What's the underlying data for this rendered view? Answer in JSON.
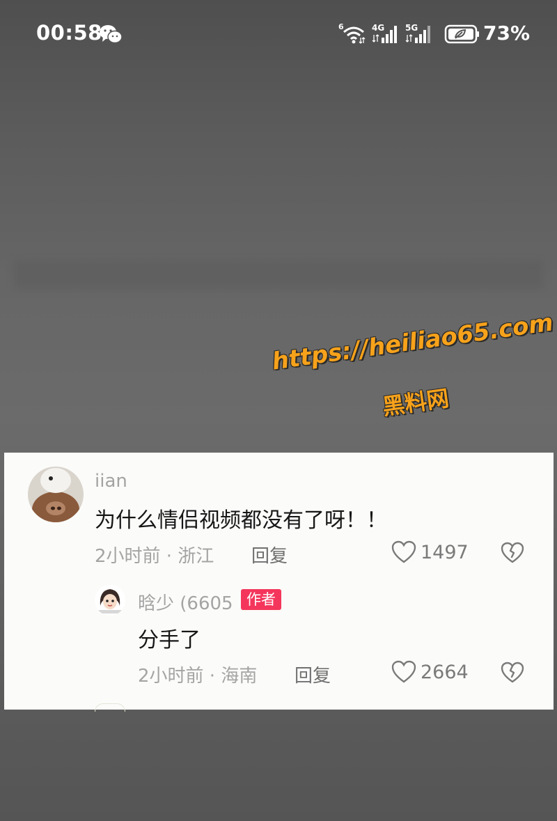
{
  "status_bar": {
    "time": "00:58",
    "icons": [
      "wechat-icon",
      "wifi-icon",
      "signal-4g-icon",
      "signal-5g-icon",
      "battery-icon"
    ],
    "wifi_badge": "6",
    "signal1_label": "4G",
    "signal2_label": "5G",
    "battery": "73%"
  },
  "watermark": {
    "url": "https://heiliao65.com",
    "name": "黑料网"
  },
  "comment": {
    "username": "iian",
    "text": "为什么情侣视频都没有了呀！！",
    "time_location": "2小时前 · 浙江",
    "reply_label": "回复",
    "likes": "1497"
  },
  "reply": {
    "username": "晗少 (6605",
    "badge": "作者",
    "text": "分手了",
    "time_location": "2小时前 · 海南",
    "reply_label": "回复",
    "likes": "2664"
  },
  "colors": {
    "badge": "#f4365c",
    "watermark": "#f7a21b",
    "card_bg": "#fbfbf9"
  }
}
